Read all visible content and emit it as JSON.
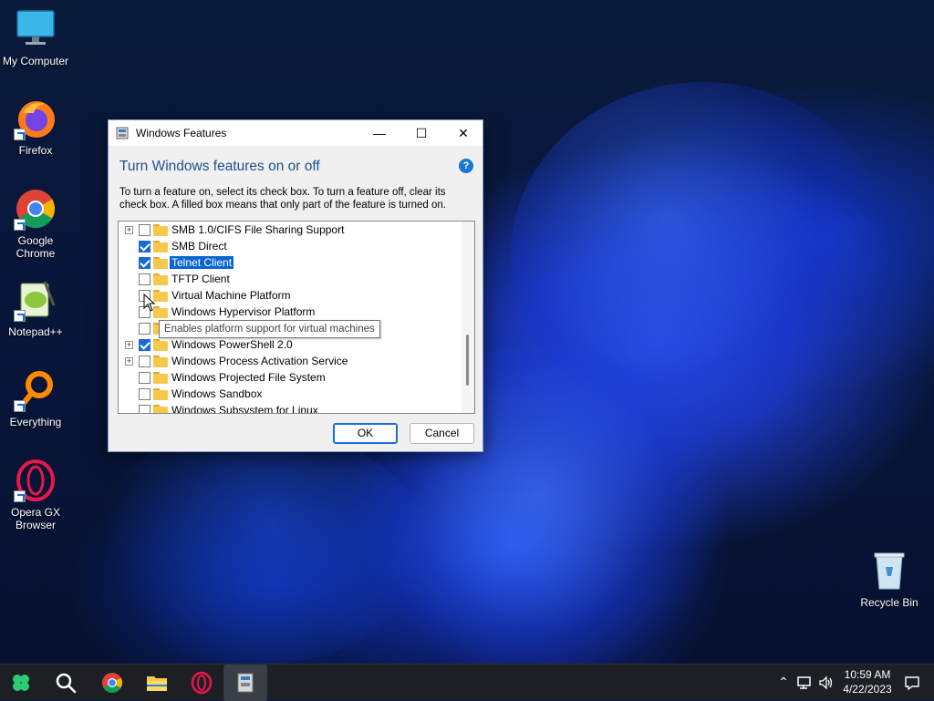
{
  "desktop": {
    "icons": [
      {
        "label": "My Computer"
      },
      {
        "label": "Firefox"
      },
      {
        "label": "Google Chrome"
      },
      {
        "label": "Notepad++"
      },
      {
        "label": "Everything"
      },
      {
        "label": "Opera GX Browser"
      },
      {
        "label": "Recycle Bin"
      }
    ]
  },
  "dialog": {
    "title": "Windows Features",
    "heading": "Turn Windows features on or off",
    "description": "To turn a feature on, select its check box. To turn a feature off, clear its check box. A filled box means that only part of the feature is turned on.",
    "help_glyph": "?",
    "minimize_glyph": "—",
    "maximize_glyph": "☐",
    "close_glyph": "✕",
    "features": [
      {
        "label": "SMB 1.0/CIFS File Sharing Support",
        "expandable": true,
        "checked": false,
        "selected": false
      },
      {
        "label": "SMB Direct",
        "expandable": false,
        "checked": true,
        "selected": false
      },
      {
        "label": "Telnet Client",
        "expandable": false,
        "checked": true,
        "selected": true
      },
      {
        "label": "TFTP Client",
        "expandable": false,
        "checked": false,
        "selected": false
      },
      {
        "label": "Virtual Machine Platform",
        "expandable": false,
        "checked": false,
        "selected": false
      },
      {
        "label": "Windows Hypervisor Platform",
        "expandable": false,
        "checked": false,
        "selected": false
      },
      {
        "label": "",
        "expandable": false,
        "checked": false,
        "selected": false
      },
      {
        "label": "Windows PowerShell 2.0",
        "expandable": true,
        "checked": true,
        "selected": false
      },
      {
        "label": "Windows Process Activation Service",
        "expandable": true,
        "checked": false,
        "selected": false
      },
      {
        "label": "Windows Projected File System",
        "expandable": false,
        "checked": false,
        "selected": false
      },
      {
        "label": "Windows Sandbox",
        "expandable": false,
        "checked": false,
        "selected": false
      },
      {
        "label": "Windows Subsystem for Linux",
        "expandable": false,
        "checked": false,
        "selected": false
      }
    ],
    "tooltip": "Enables platform support for virtual machines",
    "ok_label": "OK",
    "cancel_label": "Cancel"
  },
  "taskbar": {
    "time": "10:59 AM",
    "date": "4/22/2023"
  },
  "colors": {
    "accent": "#0a64d2",
    "heading": "#1e4f8a"
  }
}
